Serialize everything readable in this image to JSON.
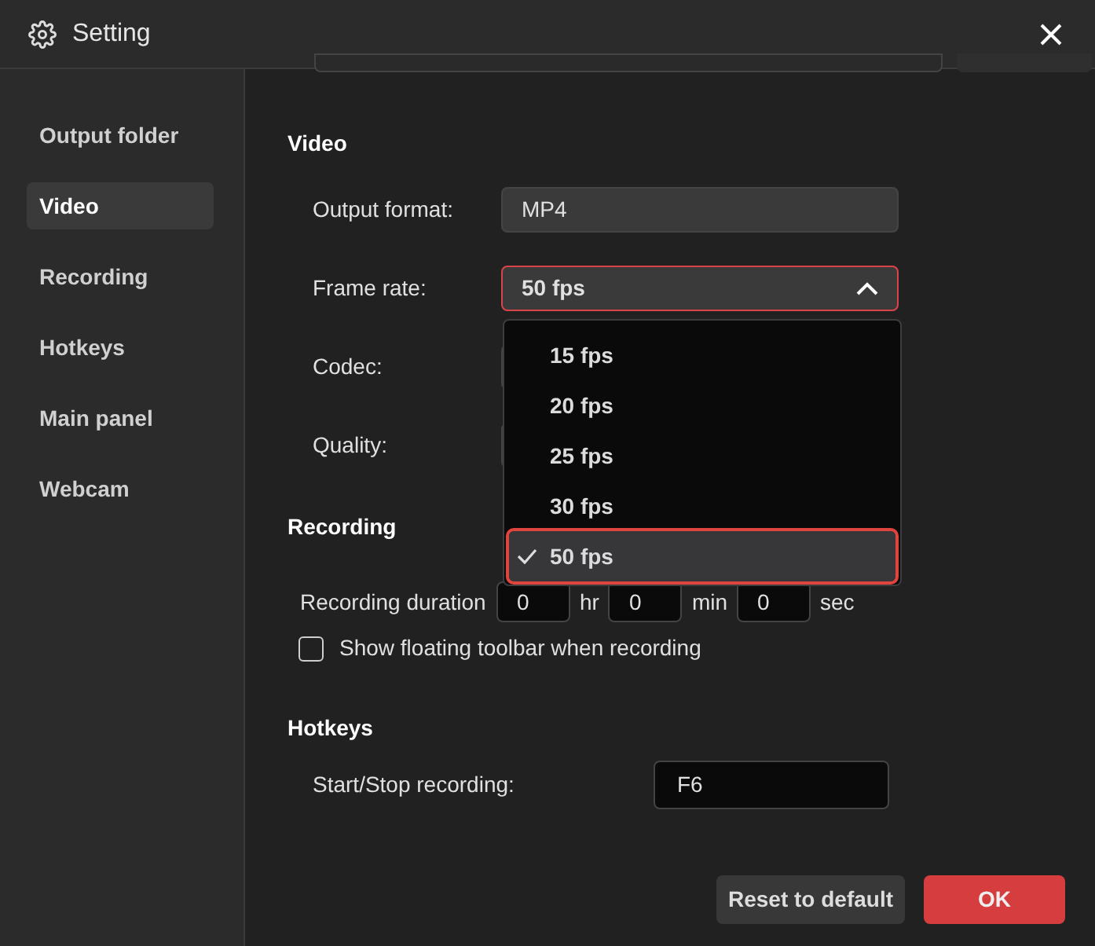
{
  "window": {
    "title": "Setting"
  },
  "sidebar": {
    "items": [
      {
        "label": "Output folder",
        "selected": false
      },
      {
        "label": "Video",
        "selected": true
      },
      {
        "label": "Recording",
        "selected": false
      },
      {
        "label": "Hotkeys",
        "selected": false
      },
      {
        "label": "Main panel",
        "selected": false
      },
      {
        "label": "Webcam",
        "selected": false
      }
    ]
  },
  "video": {
    "heading": "Video",
    "output_format": {
      "label": "Output format:",
      "value": "MP4"
    },
    "frame_rate": {
      "label": "Frame rate:",
      "value": "50 fps",
      "expanded": true,
      "options": [
        {
          "label": "15 fps",
          "selected": false
        },
        {
          "label": "20 fps",
          "selected": false
        },
        {
          "label": "25 fps",
          "selected": false
        },
        {
          "label": "30 fps",
          "selected": false
        },
        {
          "label": "50 fps",
          "selected": true
        }
      ]
    },
    "codec": {
      "label": "Codec:"
    },
    "quality": {
      "label": "Quality:"
    }
  },
  "recording": {
    "heading": "Recording",
    "duration": {
      "label": "Recording duration",
      "fields": [
        {
          "value": "0",
          "unit": "hr"
        },
        {
          "value": "0",
          "unit": "min"
        },
        {
          "value": "0",
          "unit": "sec"
        }
      ]
    },
    "floating_toolbar": {
      "label": "Show floating toolbar when recording",
      "checked": false
    }
  },
  "hotkeys": {
    "heading": "Hotkeys",
    "start_stop": {
      "label": "Start/Stop recording:",
      "value": "F6"
    }
  },
  "buttons": {
    "reset": "Reset to default",
    "ok": "OK"
  }
}
